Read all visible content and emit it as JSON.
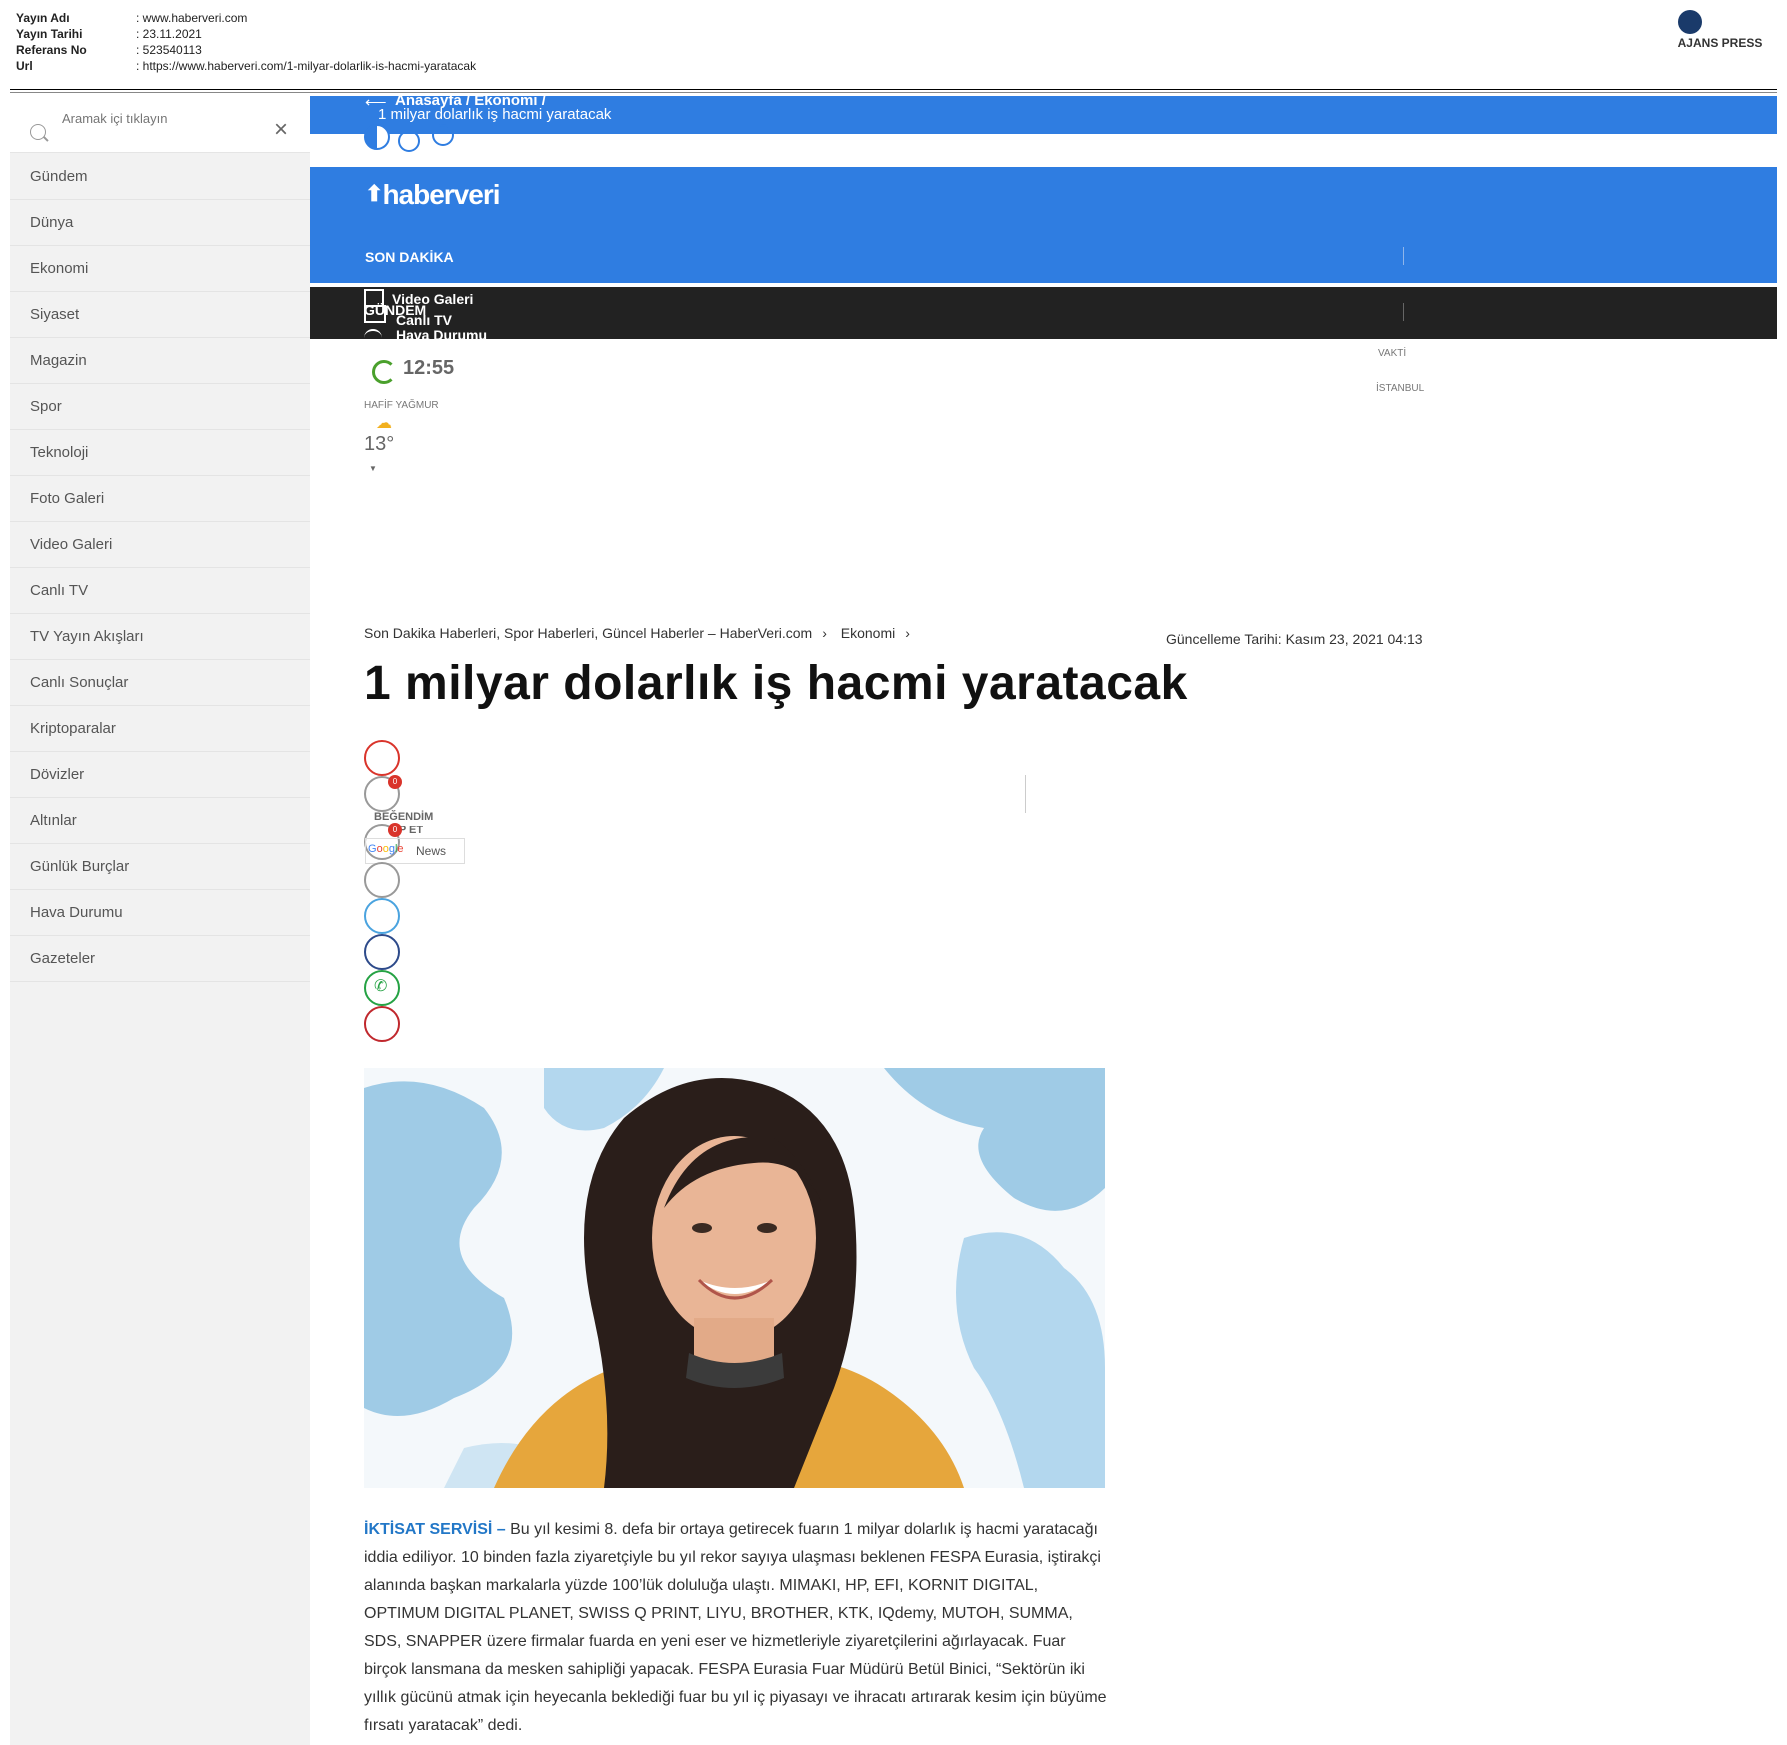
{
  "meta": {
    "rows": [
      {
        "key": "Yayın Adı",
        "value": ": www.haberveri.com"
      },
      {
        "key": "Yayın Tarihi",
        "value": ": 23.11.2021"
      },
      {
        "key": "Referans No",
        "value": ": 523540113"
      },
      {
        "key": "Url",
        "value": ": https://www.haberveri.com/1-milyar-dolarlik-is-hacmi-yaratacak"
      }
    ],
    "logo_text": "AJANS PRESS"
  },
  "sidebar": {
    "search_placeholder": "Aramak içi tıklayın",
    "items": [
      "Gündem",
      "Dünya",
      "Ekonomi",
      "Siyaset",
      "Magazin",
      "Spor",
      "Teknoloji",
      "Foto Galeri",
      "Video Galeri",
      "Canlı TV",
      "TV Yayın Akışları",
      "Canlı Sonuçlar",
      "Kriptoparalar",
      "Dövizler",
      "Altınlar",
      "Günlük Burçlar",
      "Hava Durumu",
      "Gazeteler"
    ]
  },
  "topbar": {
    "crumbs": "Anasayfa   /   Ekonomi   /",
    "title": "1 milyar dolarlık iş hacmi yaratacak"
  },
  "header": {
    "brand": "haberveri",
    "son_dakika": "SON DAKİKA"
  },
  "blackbar": {
    "gundem": "GÜNDEM",
    "video": "Video Galeri",
    "canli": "Canlı TV",
    "hava": "Hava Durumu"
  },
  "weather": {
    "time": "12:55",
    "vakti": "VAKTİ",
    "city": "İSTANBUL",
    "condition": "HAFİF YAĞMUR",
    "temp": "13°"
  },
  "article": {
    "breadcrumb_home": "Son Dakika Haberleri, Spor Haberleri, Güncel Haberler – HaberVeri.com",
    "breadcrumb_cat": "Ekonomi",
    "updated": "Güncelleme Tarihi: Kasım 23, 2021 04:13",
    "title": "1 milyar dolarlık iş hacmi yaratacak",
    "like_label": "BEĞENDİM",
    "follow_label": "TAKİP ET",
    "like_count": "0",
    "dislike_count": "0",
    "gnews": "News",
    "lead": "İKTİSAT SERVİSİ –",
    "text": " Bu yıl kesimi 8. defa bir ortaya getirecek fuarın 1 milyar dolarlık iş hacmi yaratacağı iddia ediliyor. 10 binden fazla ziyaretçiyle bu yıl rekor sayıya ulaşması beklenen FESPA Eurasia, iştirakçi alanında başkan markalarla yüzde 100’lük doluluğa ulaştı. MIMAKI, HP, EFI, KORNIT DIGITAL, OPTIMUM DIGITAL PLANET, SWISS Q PRINT, LIYU, BROTHER, KTK, IQdemy, MUTOH, SUMMA, SDS, SNAPPER üzere firmalar fuarda en yeni eser ve hizmetleriyle ziyaretçilerini ağırlayacak. Fuar birçok lansmana da mesken sahipliği yapacak. FESPA Eurasia Fuar Müdürü Betül Binici, “Sektörün iki yıllık gücünü atmak için heyecanla beklediği fuar bu yıl iç piyasayı ve ihracatı artırarak kesim için büyüme fırsatı yaratacak” dedi."
  }
}
